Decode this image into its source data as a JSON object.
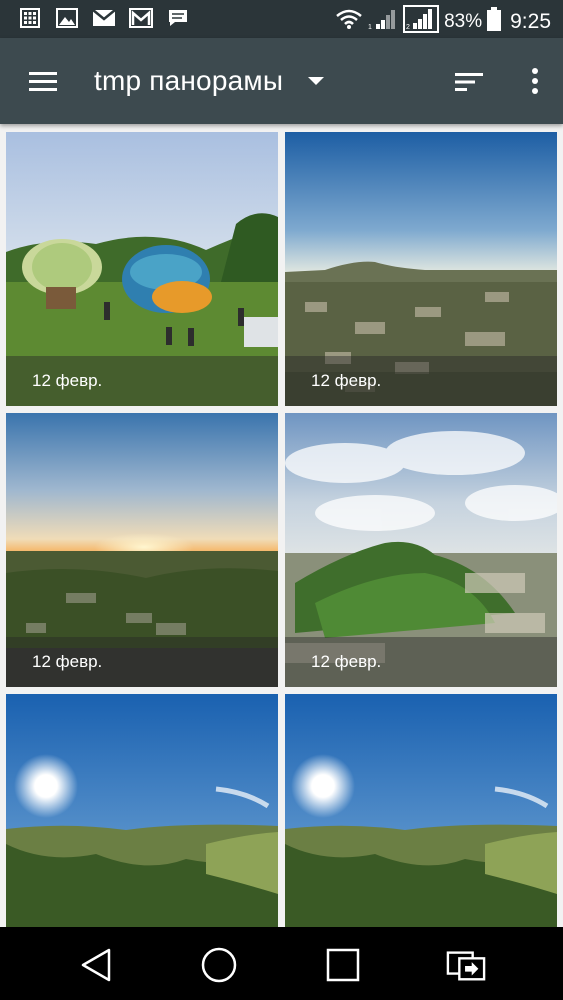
{
  "status_bar": {
    "battery_percent": "83%",
    "time": "9:25",
    "left_icons": [
      "calculator-icon",
      "image-icon",
      "mail-icon",
      "gmail-icon",
      "message-icon"
    ],
    "right_icons": [
      "wifi-icon",
      "signal-1-icon",
      "signal-2-icon",
      "battery-icon"
    ]
  },
  "app_bar": {
    "title": "tmp панорамы",
    "icons": [
      "menu-icon",
      "dropdown-arrow-icon",
      "sort-icon",
      "more-vert-icon"
    ]
  },
  "grid": {
    "items": [
      {
        "date": "12 февр.",
        "scene": "hot-air-balloons-field"
      },
      {
        "date": "12 февр.",
        "scene": "aerial-city-mountain"
      },
      {
        "date": "12 февр.",
        "scene": "sunset-over-town"
      },
      {
        "date": "12 февр.",
        "scene": "green-mountain-aerial"
      },
      {
        "date": "",
        "scene": "sun-over-valley"
      },
      {
        "date": "",
        "scene": "sun-over-valley"
      }
    ]
  },
  "nav_bar": {
    "icons": [
      "back-icon",
      "home-icon",
      "recents-icon",
      "dual-window-icon"
    ]
  },
  "colors": {
    "status_bar": "#2b3539",
    "app_bar": "#3d4a4f",
    "background": "#f2f2f2",
    "nav_bar": "#000000"
  }
}
